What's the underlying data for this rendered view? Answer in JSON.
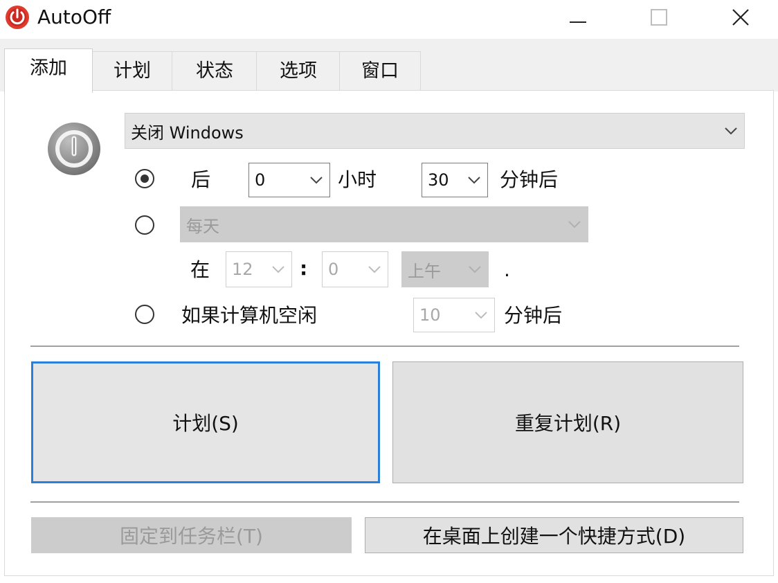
{
  "window": {
    "title": "AutoOff",
    "icon": "power-icon",
    "brand_color": "#e03a2f"
  },
  "tabs": [
    {
      "label": "添加",
      "active": true
    },
    {
      "label": "计划",
      "active": false
    },
    {
      "label": "状态",
      "active": false
    },
    {
      "label": "选项",
      "active": false
    },
    {
      "label": "窗口",
      "active": false
    }
  ],
  "action": {
    "selected": "关闭 Windows"
  },
  "after": {
    "label": "后",
    "selected": true,
    "hours_value": "0",
    "hours_unit": "小时",
    "minutes_value": "30",
    "minutes_unit": "分钟后"
  },
  "schedule": {
    "selected": false,
    "frequency_value": "每天",
    "at_label": "在",
    "hour_value": "12",
    "separator": ":",
    "minute_value": "0",
    "ampm_value": "上午",
    "trailing": "."
  },
  "idle": {
    "selected": false,
    "label": "如果计算机空闲",
    "minutes_value": "10",
    "minutes_unit": "分钟后"
  },
  "buttons": {
    "schedule": "计划(S)",
    "repeat_schedule": "重复计划(R)",
    "pin_taskbar": "固定到任务栏(T)",
    "desktop_shortcut": "在桌面上创建一个快捷方式(D)"
  },
  "colors": {
    "focus_border": "#2b7fd6",
    "button_face": "#e1e1e1",
    "disabled_face": "#cccccc"
  }
}
